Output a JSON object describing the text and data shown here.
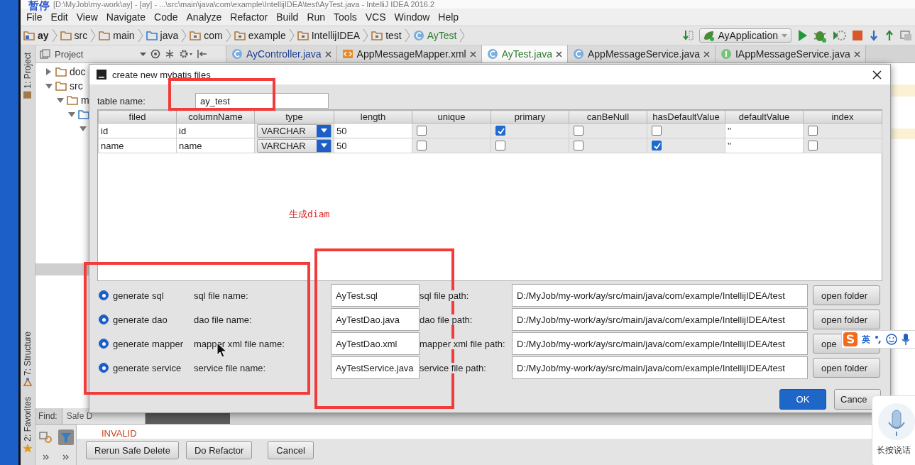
{
  "title_bar": {
    "title": "[D:\\MyJob\\my-work\\ay] - [ay] - ...\\src\\main\\java\\com\\example\\IntellijIDEA\\test\\AyTest.java - IntelliJ IDEA 2016.2",
    "overlay_label": "暂停"
  },
  "menu": [
    "File",
    "Edit",
    "View",
    "Navigate",
    "Code",
    "Analyze",
    "Refactor",
    "Build",
    "Run",
    "Tools",
    "VCS",
    "Window",
    "Help"
  ],
  "breadcrumbs": [
    {
      "label": "ay",
      "kind": "module",
      "color": "#1f1f1f"
    },
    {
      "label": "src",
      "kind": "folder",
      "color": "#1f1f1f"
    },
    {
      "label": "main",
      "kind": "folder",
      "color": "#1f1f1f"
    },
    {
      "label": "java",
      "kind": "source",
      "color": "#1f1f1f"
    },
    {
      "label": "com",
      "kind": "package",
      "color": "#1f1f1f"
    },
    {
      "label": "example",
      "kind": "package",
      "color": "#1f1f1f"
    },
    {
      "label": "IntellijIDEA",
      "kind": "package",
      "color": "#1f1f1f"
    },
    {
      "label": "test",
      "kind": "package",
      "color": "#1f1f1f"
    },
    {
      "label": "AyTest",
      "kind": "class",
      "color": "#2f7a2f"
    }
  ],
  "run_config": {
    "label": "AyApplication"
  },
  "project_panel": {
    "title": "Project"
  },
  "editor_tabs": [
    {
      "label": "AyController.java",
      "kind": "class",
      "selected": false,
      "color": "#1f3f8f"
    },
    {
      "label": "AppMessageMapper.xml",
      "kind": "xml",
      "selected": false,
      "color": "#1f1f1f"
    },
    {
      "label": "AyTest.java",
      "kind": "class",
      "selected": true,
      "color": "#2f7a2f"
    },
    {
      "label": "AppMessageService.java",
      "kind": "class",
      "selected": false,
      "color": "#1f1f1f"
    },
    {
      "label": "IAppMessageService.java",
      "kind": "interface",
      "selected": false,
      "color": "#1f1f1f"
    }
  ],
  "tool_strip": [
    {
      "label": "1: Project",
      "kind": "project"
    },
    {
      "label": "7: Structure",
      "kind": "structure"
    },
    {
      "label": "2: Favorites",
      "kind": "favorites"
    }
  ],
  "project_tree": [
    {
      "label": "doc",
      "kind": "folder",
      "expanded": false
    },
    {
      "label": "src",
      "kind": "folder",
      "expanded": true,
      "children": [
        {
          "label": "m",
          "kind": "folder",
          "expanded": true,
          "children": [
            {
              "kind": "source",
              "expanded": true,
              "children": [
                {
                  "expanded": true
                }
              ]
            }
          ]
        }
      ]
    }
  ],
  "dialog": {
    "title": "create new mybatis files",
    "table_name": {
      "label": "table name:",
      "value": "ay_test"
    },
    "table": {
      "columns": [
        {
          "label": "filed",
          "kind": "text"
        },
        {
          "label": "columnName",
          "kind": "text"
        },
        {
          "label": "type",
          "kind": "dropdown"
        },
        {
          "label": "length",
          "kind": "text"
        },
        {
          "label": "unique",
          "kind": "checkbox"
        },
        {
          "label": "primary",
          "kind": "checkbox"
        },
        {
          "label": "canBeNull",
          "kind": "checkbox"
        },
        {
          "label": "hasDefaultValue",
          "kind": "checkbox"
        },
        {
          "label": "defaultValue",
          "kind": "text"
        },
        {
          "label": "index",
          "kind": "checkbox"
        }
      ],
      "rows": [
        {
          "cells": [
            {
              "value": "id"
            },
            {
              "value": "id"
            },
            {
              "value": "VARCHAR"
            },
            {
              "value": "50"
            },
            {
              "checked": false
            },
            {
              "checked": true
            },
            {
              "checked": false
            },
            {
              "checked": false
            },
            {
              "value": "''"
            },
            {
              "checked": false
            }
          ]
        },
        {
          "cells": [
            {
              "value": "name"
            },
            {
              "value": "name"
            },
            {
              "value": "VARCHAR"
            },
            {
              "value": "50"
            },
            {
              "checked": false
            },
            {
              "checked": false
            },
            {
              "checked": false
            },
            {
              "checked": true
            },
            {
              "value": "''"
            },
            {
              "checked": false
            }
          ]
        }
      ]
    },
    "generators": [
      {
        "label": "generate sql",
        "checked": true,
        "name_label": "sql file name:",
        "file_name": "AyTest.sql",
        "path_label": "sql file path:",
        "path": "D:/MyJob/my-work/ay/src/main/java/com/example/IntellijIDEA/test",
        "button": "open folder"
      },
      {
        "label": "generate dao",
        "checked": true,
        "name_label": "dao file name:",
        "file_name": "AyTestDao.java",
        "path_label": "dao file path:",
        "path": "D:/MyJob/my-work/ay/src/main/java/com/example/IntellijIDEA/test",
        "button": "open folder"
      },
      {
        "label": "generate mapper",
        "checked": true,
        "name_label": "mapper xml file name:",
        "file_name": "AyTestDao.xml",
        "path_label": "mapper xml file path:",
        "path": "D:/MyJob/my-work/ay/src/main/java/com/example/IntellijIDEA/test",
        "button": "ope"
      },
      {
        "label": "generate service",
        "checked": true,
        "name_label": "service file name:",
        "file_name": "AyTestService.java",
        "path_label": "service file path:",
        "path": "D:/MyJob/my-work/ay/src/main/java/com/example/IntellijIDEA/test",
        "button": "open folder"
      }
    ],
    "buttons": [
      {
        "label": "OK",
        "kind": "primary"
      },
      {
        "label": "Cance",
        "kind": "normal"
      }
    ]
  },
  "bottom_panel": {
    "find_label": "Find:",
    "find_tab": "Safe D",
    "status": "INVALID",
    "buttons": [
      "Rerun Safe Delete",
      "Do Refactor",
      "Cancel"
    ]
  },
  "annotations": [
    {
      "kind": "frame"
    },
    {
      "kind": "frame"
    },
    {
      "kind": "frame"
    },
    {
      "kind": "text",
      "text": "生成diam"
    }
  ],
  "ime_bar": {
    "mode": "英"
  },
  "voice_widget": {
    "label": "长按说话"
  }
}
